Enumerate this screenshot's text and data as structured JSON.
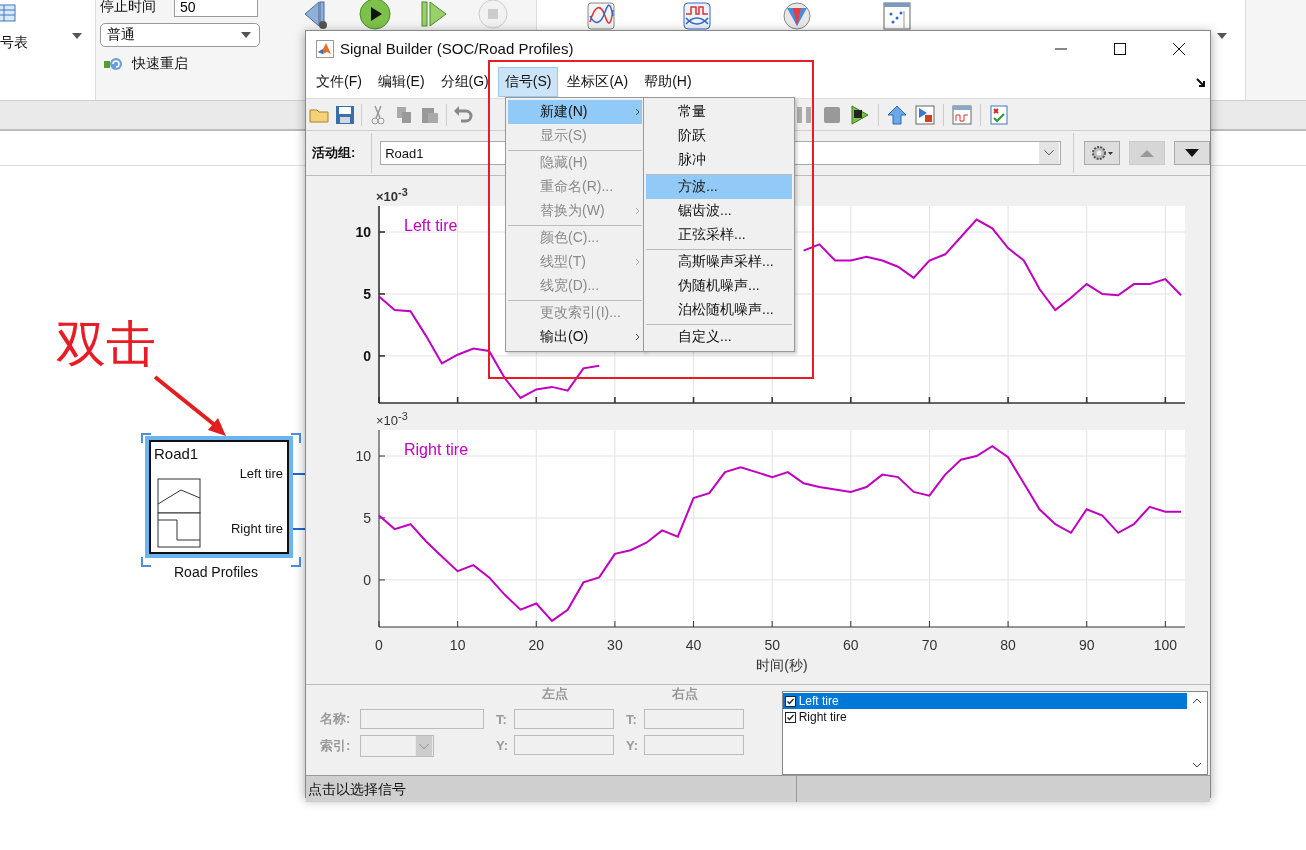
{
  "ribbon": {
    "gallery_label": "号表",
    "stop_time": {
      "label": "停止时间",
      "value": "50"
    },
    "sim_mode": {
      "value": "普通"
    },
    "fast_restart": {
      "label": "快速重启"
    }
  },
  "canvas": {
    "annotation": "双击",
    "block": {
      "name": "Road1",
      "selected": true,
      "ports": [
        "Left tire",
        "Right tire"
      ],
      "caption": "Road Profiles"
    }
  },
  "window": {
    "title": "Signal Builder (SOC/Road Profiles)",
    "menu_bar": [
      {
        "label": "文件(F)",
        "selected": false
      },
      {
        "label": "编辑(E)",
        "selected": false
      },
      {
        "label": "分组(G)",
        "selected": false
      },
      {
        "label": "信号(S)",
        "selected": true
      },
      {
        "label": "坐标区(A)",
        "selected": false
      },
      {
        "label": "帮助(H)",
        "selected": false
      }
    ],
    "signal_menu": [
      {
        "label": "新建(N)",
        "disabled": false,
        "selected": true,
        "submenu": true,
        "separator_before": false
      },
      {
        "label": "显示(S)",
        "disabled": true,
        "selected": false,
        "submenu": false,
        "separator_before": false
      },
      {
        "label": "隐藏(H)",
        "disabled": true,
        "selected": false,
        "submenu": false,
        "separator_before": true
      },
      {
        "label": "重命名(R)...",
        "disabled": true,
        "selected": false,
        "submenu": false,
        "separator_before": false
      },
      {
        "label": "替换为(W)",
        "disabled": true,
        "selected": false,
        "submenu": true,
        "separator_before": false
      },
      {
        "label": "颜色(C)...",
        "disabled": true,
        "selected": false,
        "submenu": false,
        "separator_before": true
      },
      {
        "label": "线型(T)",
        "disabled": true,
        "selected": false,
        "submenu": true,
        "separator_before": false
      },
      {
        "label": "线宽(D)...",
        "disabled": true,
        "selected": false,
        "submenu": false,
        "separator_before": false
      },
      {
        "label": "更改索引(I)...",
        "disabled": true,
        "selected": false,
        "submenu": false,
        "separator_before": true
      },
      {
        "label": "输出(O)",
        "disabled": false,
        "selected": false,
        "submenu": true,
        "separator_before": false
      }
    ],
    "new_submenu": [
      {
        "label": "常量",
        "selected": false,
        "separator_before": false
      },
      {
        "label": "阶跃",
        "selected": false,
        "separator_before": false
      },
      {
        "label": "脉冲",
        "selected": false,
        "separator_before": false
      },
      {
        "label": "方波...",
        "selected": true,
        "separator_before": true
      },
      {
        "label": "锯齿波...",
        "selected": false,
        "separator_before": false
      },
      {
        "label": "正弦采样...",
        "selected": false,
        "separator_before": false
      },
      {
        "label": "高斯噪声采样...",
        "selected": false,
        "separator_before": true
      },
      {
        "label": "伪随机噪声...",
        "selected": false,
        "separator_before": false
      },
      {
        "label": "泊松随机噪声...",
        "selected": false,
        "separator_before": false
      },
      {
        "label": "自定义...",
        "selected": false,
        "separator_before": true
      }
    ],
    "active_group": {
      "label": "活动组:",
      "value": "Road1"
    },
    "axes": [
      {
        "selected": true,
        "y_multiplier": "×10$^{-3}$",
        "chart_data": {
          "type": "line",
          "grid": true,
          "x": [
            0,
            2,
            4,
            6,
            8,
            10,
            12,
            14,
            16,
            18,
            20,
            22,
            24,
            26,
            28,
            30,
            32,
            34,
            36,
            38,
            40,
            42,
            44,
            46,
            48,
            50,
            52,
            54,
            56,
            58,
            60,
            62,
            64,
            66,
            68,
            70,
            72,
            74,
            76,
            78,
            80,
            82,
            84,
            86,
            88,
            90,
            92,
            94,
            96,
            98,
            100,
            102
          ],
          "series": [
            {
              "name": "Left tire",
              "color": "#c000c0",
              "values": [
                4.8,
                3.7,
                3.6,
                1.6,
                -0.6,
                0.1,
                0.6,
                0.4,
                -1.8,
                -3.4,
                -2.7,
                -2.5,
                -2.8,
                -1.0,
                -0.8,
                null,
                null,
                null,
                null,
                null,
                null,
                null,
                null,
                null,
                null,
                null,
                null,
                8.5,
                9.0,
                7.7,
                7.7,
                8.0,
                7.7,
                7.2,
                6.3,
                7.7,
                8.2,
                9.6,
                11.0,
                10.3,
                8.7,
                7.7,
                5.4,
                3.7,
                4.7,
                5.8,
                5.0,
                4.9,
                5.8,
                5.8,
                6.2,
                4.9
              ]
            }
          ],
          "xlim": [
            0,
            102.5
          ],
          "ylim": [
            -3.8,
            12.1
          ],
          "yticks": [
            0,
            5,
            10
          ]
        }
      },
      {
        "selected": false,
        "y_multiplier": "×10$^{-3}$",
        "chart_data": {
          "type": "line",
          "grid": true,
          "xlabel": "时间(秒)",
          "x": [
            0,
            2,
            4,
            6,
            8,
            10,
            12,
            14,
            16,
            18,
            20,
            22,
            24,
            26,
            28,
            30,
            32,
            34,
            36,
            38,
            40,
            42,
            44,
            46,
            48,
            50,
            52,
            54,
            56,
            58,
            60,
            62,
            64,
            66,
            68,
            70,
            72,
            74,
            76,
            78,
            80,
            82,
            84,
            86,
            88,
            90,
            92,
            94,
            96,
            98,
            100,
            102
          ],
          "series": [
            {
              "name": "Right tire",
              "color": "#c000c0",
              "values": [
                5.2,
                4.1,
                4.5,
                3.1,
                1.9,
                0.7,
                1.2,
                0.2,
                -1.2,
                -2.4,
                -1.9,
                -3.3,
                -2.4,
                -0.2,
                0.2,
                2.1,
                2.4,
                3.0,
                4.0,
                3.5,
                6.6,
                7.0,
                8.7,
                9.1,
                8.7,
                8.3,
                8.7,
                7.8,
                7.5,
                7.3,
                7.1,
                7.5,
                8.5,
                8.3,
                7.1,
                6.8,
                8.5,
                9.7,
                10.0,
                10.8,
                9.9,
                7.8,
                5.7,
                4.5,
                3.8,
                5.7,
                5.2,
                3.8,
                4.5,
                5.9,
                5.5,
                5.5
              ]
            }
          ],
          "xlim": [
            0,
            102.5
          ],
          "ylim": [
            -3.8,
            12.1
          ],
          "xticks": [
            0,
            10,
            20,
            30,
            40,
            50,
            60,
            70,
            80,
            90,
            100
          ],
          "yticks": [
            0,
            5,
            10
          ]
        }
      }
    ],
    "point_panel": {
      "disabled": true,
      "name_label": "名称:",
      "index_label": "索引:",
      "left_point": {
        "title": "左点",
        "t_label": "T:",
        "y_label": "Y:"
      },
      "right_point": {
        "title": "右点",
        "t_label": "T:",
        "y_label": "Y:"
      }
    },
    "signal_list": [
      {
        "label": "Left tire",
        "checked": true,
        "selected": true
      },
      {
        "label": "Right tire",
        "checked": true,
        "selected": false
      }
    ],
    "status_bar": "点击以选择信号"
  }
}
